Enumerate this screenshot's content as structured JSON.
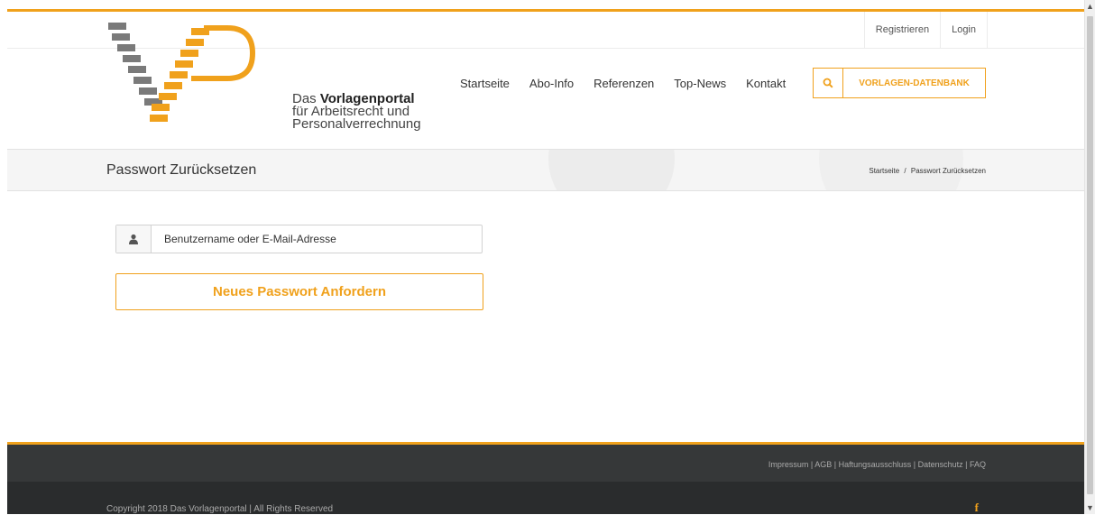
{
  "header": {
    "secondary_nav": [
      "Registrieren",
      "Login"
    ],
    "logo": {
      "line1_prefix": "Das ",
      "line1_bold": "Vorlagenportal",
      "line2": "für Arbeitsrecht und",
      "line3": "Personalverrechnung"
    },
    "main_nav": [
      "Startseite",
      "Abo-Info",
      "Referenzen",
      "Top-News",
      "Kontakt"
    ],
    "search_icon": "search-icon",
    "db_button_label": "VORLAGEN-DATENBANK"
  },
  "page_title_bar": {
    "title": "Passwort Zurücksetzen",
    "breadcrumb": {
      "home": "Startseite",
      "separator": "/",
      "current": "Passwort Zurücksetzen"
    }
  },
  "form": {
    "user_icon": "user-icon",
    "username_placeholder": "Benutzername oder E-Mail-Adresse",
    "username_value": "",
    "submit_label": "Neues Passwort Anfordern"
  },
  "footer": {
    "links": [
      "Impressum",
      "AGB",
      "Haftungsausschluss",
      "Datenschutz",
      "FAQ"
    ],
    "link_separator": "|",
    "copyright": "Copyright 2018 Das Vorlagenportal | All Rights Reserved",
    "social_icon": "facebook-icon",
    "social_glyph": "f"
  },
  "colors": {
    "accent": "#f0a11c",
    "logo_gray": "#7a7a7a",
    "footer_top": "#363839",
    "footer_bottom": "#2a2c2d"
  }
}
